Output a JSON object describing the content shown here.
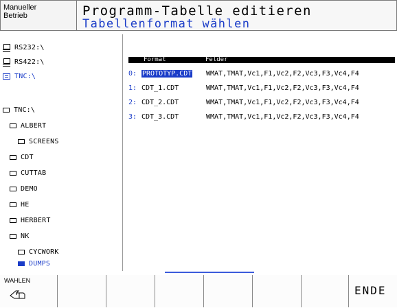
{
  "header": {
    "mode_line1": "Manueller",
    "mode_line2": "Betrieb",
    "title": "Programm-Tabelle editieren",
    "subtitle": "Tabellenformat wählen"
  },
  "tree": {
    "items": [
      {
        "label": "RS232:\\",
        "icon": "drive-icon"
      },
      {
        "label": "RS422:\\",
        "icon": "drive-icon"
      },
      {
        "label": "TNC:\\",
        "icon": "tnc-drive-icon"
      },
      {
        "label": "TNC:\\",
        "icon": "folder-icon"
      },
      {
        "label": "ALBERT",
        "icon": "folder-icon"
      },
      {
        "label": "SCREENS",
        "icon": "folder-icon"
      },
      {
        "label": "CDT",
        "icon": "folder-icon"
      },
      {
        "label": "CUTTAB",
        "icon": "folder-icon"
      },
      {
        "label": "DEMO",
        "icon": "folder-icon"
      },
      {
        "label": "HE",
        "icon": "folder-icon"
      },
      {
        "label": "HERBERT",
        "icon": "folder-icon"
      },
      {
        "label": "NK",
        "icon": "folder-icon"
      },
      {
        "label": "CYCWORK",
        "icon": "folder-icon"
      },
      {
        "label": "DUMPS",
        "icon": "folder-open-icon",
        "selected": true
      }
    ]
  },
  "table": {
    "col_format": "Format",
    "col_felder": "Felder",
    "rows": [
      {
        "idx": "0:",
        "format": "PROTOTYP.CDT",
        "felder": "WMAT,TMAT,Vc1,F1,Vc2,F2,Vc3,F3,Vc4,F4",
        "selected": true
      },
      {
        "idx": "1:",
        "format": "CDT_1.CDT",
        "felder": "WMAT,TMAT,Vc1,F1,Vc2,F2,Vc3,F3,Vc4,F4"
      },
      {
        "idx": "2:",
        "format": "CDT_2.CDT",
        "felder": "WMAT,TMAT,Vc1,F1,Vc2,F2,Vc3,F3,Vc4,F4"
      },
      {
        "idx": "3:",
        "format": "CDT_3.CDT",
        "felder": "WMAT,TMAT,Vc1,F1,Vc2,F2,Vc3,F3,Vc4,F4"
      }
    ]
  },
  "softkeys": {
    "waehlen": "WAHLEN",
    "ende": "ENDE"
  },
  "colors": {
    "accent": "#1a3cc8",
    "selection": "#3b5bdb"
  }
}
